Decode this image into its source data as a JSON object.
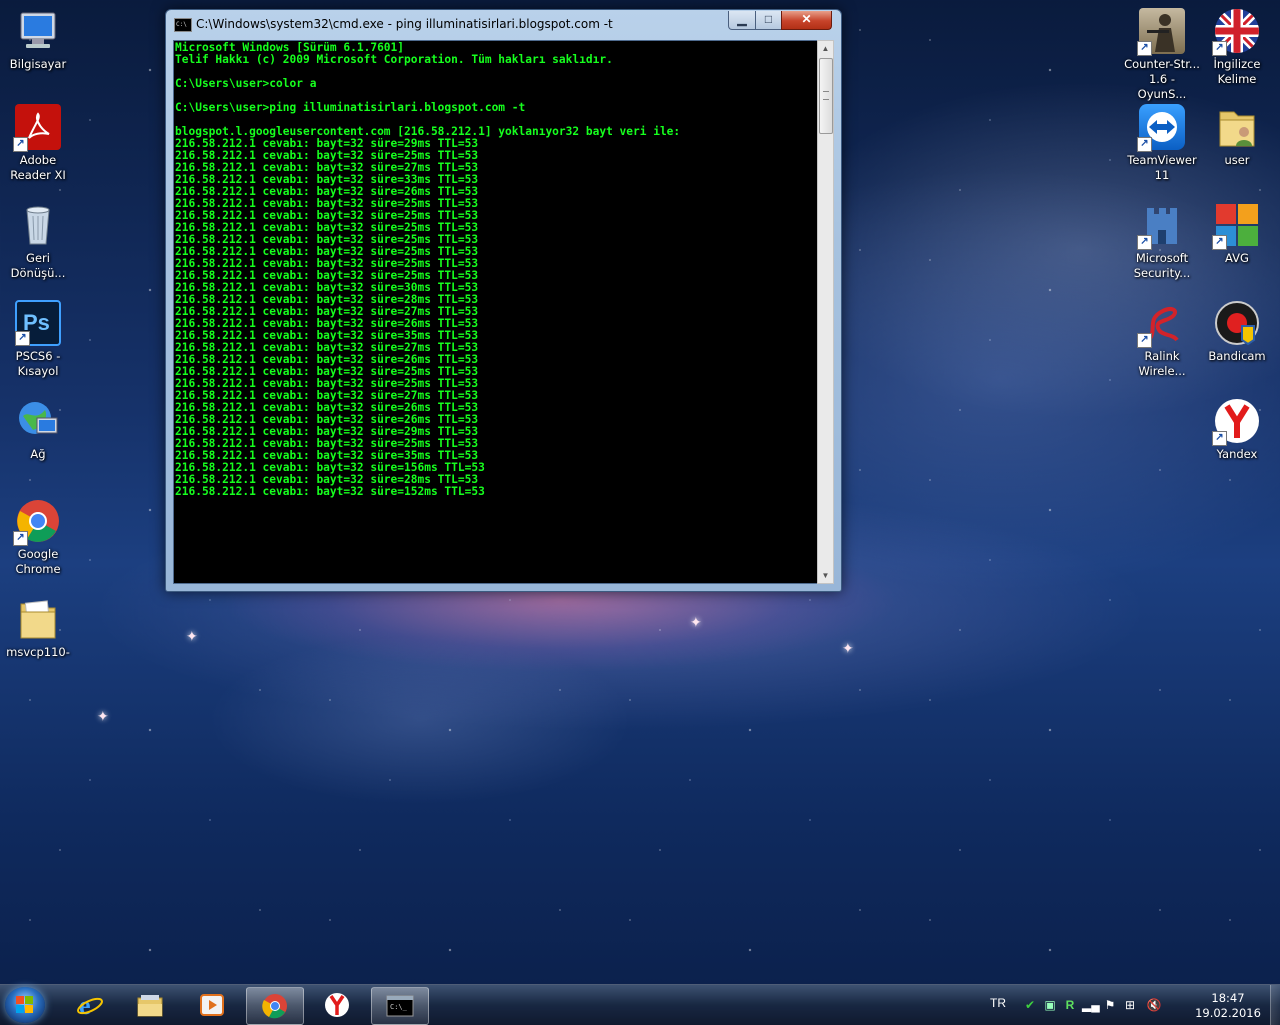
{
  "window": {
    "title": "C:\\Windows\\system32\\cmd.exe - ping  illuminatisirlari.blogspot.com -t",
    "console_lines": [
      "Microsoft Windows [Sürüm 6.1.7601]",
      "Telif Hakkı (c) 2009 Microsoft Corporation. Tüm hakları saklıdır.",
      "",
      "C:\\Users\\user>color a",
      "",
      "C:\\Users\\user>ping illuminatisirlari.blogspot.com -t",
      "",
      "blogspot.l.googleusercontent.com [216.58.212.1] yoklanıyor32 bayt veri ile:",
      "216.58.212.1 cevabı: bayt=32 süre=29ms TTL=53",
      "216.58.212.1 cevabı: bayt=32 süre=25ms TTL=53",
      "216.58.212.1 cevabı: bayt=32 süre=27ms TTL=53",
      "216.58.212.1 cevabı: bayt=32 süre=33ms TTL=53",
      "216.58.212.1 cevabı: bayt=32 süre=26ms TTL=53",
      "216.58.212.1 cevabı: bayt=32 süre=25ms TTL=53",
      "216.58.212.1 cevabı: bayt=32 süre=25ms TTL=53",
      "216.58.212.1 cevabı: bayt=32 süre=25ms TTL=53",
      "216.58.212.1 cevabı: bayt=32 süre=25ms TTL=53",
      "216.58.212.1 cevabı: bayt=32 süre=25ms TTL=53",
      "216.58.212.1 cevabı: bayt=32 süre=25ms TTL=53",
      "216.58.212.1 cevabı: bayt=32 süre=25ms TTL=53",
      "216.58.212.1 cevabı: bayt=32 süre=30ms TTL=53",
      "216.58.212.1 cevabı: bayt=32 süre=28ms TTL=53",
      "216.58.212.1 cevabı: bayt=32 süre=27ms TTL=53",
      "216.58.212.1 cevabı: bayt=32 süre=26ms TTL=53",
      "216.58.212.1 cevabı: bayt=32 süre=35ms TTL=53",
      "216.58.212.1 cevabı: bayt=32 süre=27ms TTL=53",
      "216.58.212.1 cevabı: bayt=32 süre=26ms TTL=53",
      "216.58.212.1 cevabı: bayt=32 süre=25ms TTL=53",
      "216.58.212.1 cevabı: bayt=32 süre=25ms TTL=53",
      "216.58.212.1 cevabı: bayt=32 süre=27ms TTL=53",
      "216.58.212.1 cevabı: bayt=32 süre=26ms TTL=53",
      "216.58.212.1 cevabı: bayt=32 süre=26ms TTL=53",
      "216.58.212.1 cevabı: bayt=32 süre=29ms TTL=53",
      "216.58.212.1 cevabı: bayt=32 süre=25ms TTL=53",
      "216.58.212.1 cevabı: bayt=32 süre=35ms TTL=53",
      "216.58.212.1 cevabı: bayt=32 süre=156ms TTL=53",
      "216.58.212.1 cevabı: bayt=32 süre=28ms TTL=53",
      "216.58.212.1 cevabı: bayt=32 süre=152ms TTL=53"
    ]
  },
  "desktop_left": [
    {
      "label": "Bilgisayar",
      "icon": "computer-icon"
    },
    {
      "label": "Adobe\nReader XI",
      "icon": "adobe-reader-icon"
    },
    {
      "label": "Geri\nDönüşü...",
      "icon": "recycle-bin-icon"
    },
    {
      "label": "PSCS6 -\nKısayol",
      "icon": "photoshop-icon"
    },
    {
      "label": "Ağ",
      "icon": "network-icon"
    },
    {
      "label": "Google\nChrome",
      "icon": "chrome-icon"
    },
    {
      "label": "msvcp110-",
      "icon": "folder-icon"
    }
  ],
  "desktop_right": [
    {
      "label": "Counter-Str...\n1.6 - OyunS...",
      "icon": "counter-strike-icon"
    },
    {
      "label": "İngilizce\nKelime",
      "icon": "uk-flag-icon"
    },
    {
      "label": "TeamViewer\n11",
      "icon": "teamviewer-icon"
    },
    {
      "label": "user",
      "icon": "user-folder-icon"
    },
    {
      "label": "Microsoft\nSecurity...",
      "icon": "microsoft-security-icon"
    },
    {
      "label": "AVG",
      "icon": "avg-icon"
    },
    {
      "label": "Ralink\nWirele...",
      "icon": "ralink-icon"
    },
    {
      "label": "Bandicam",
      "icon": "bandicam-icon"
    },
    {
      "label": "Yandex",
      "icon": "yandex-icon"
    }
  ],
  "taskbar": {
    "pinned": [
      "internet-explorer-icon",
      "explorer-icon",
      "media-player-icon",
      "chrome-icon",
      "yandex-icon",
      "cmd-icon"
    ],
    "language": "TR",
    "clock_time": "18:47",
    "clock_date": "19.02.2016"
  },
  "colors": {
    "console_text": "#16ff1e",
    "console_bg": "#000000"
  }
}
